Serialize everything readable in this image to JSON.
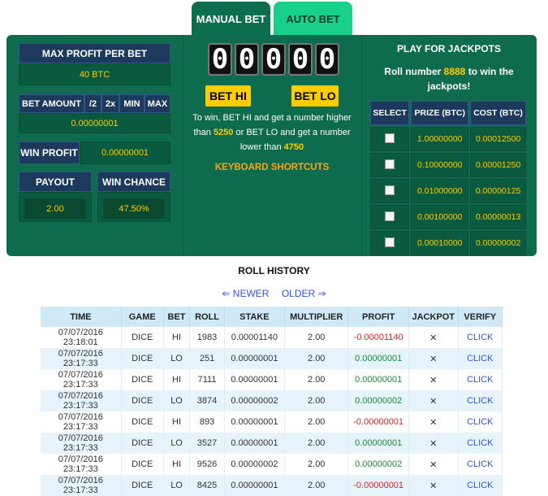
{
  "tabs": {
    "manual": "MANUAL BET",
    "auto": "AUTO BET"
  },
  "left": {
    "max_profit_label": "MAX PROFIT PER BET",
    "max_profit_value": "40 BTC",
    "bet_amount_label": "BET AMOUNT",
    "half": "/2",
    "double": "2x",
    "min": "MIN",
    "max": "MAX",
    "bet_amount_value": "0.00000001",
    "win_profit_label": "WIN PROFIT",
    "win_profit_value": "0.00000001",
    "payout_label": "PAYOUT",
    "payout_value": "2.00",
    "win_chance_label": "WIN CHANCE",
    "win_chance_value": "47.50%"
  },
  "mid": {
    "digits": [
      "0",
      "0",
      "0",
      "0",
      "0"
    ],
    "bet_hi": "BET HI",
    "bet_lo": "BET LO",
    "t1": "To win, BET HI and get a number higher than",
    "hi_num": "5250",
    "t2": "or BET LO and get a number lower than",
    "lo_num": "4750",
    "shortcuts": "KEYBOARD SHORTCUTS"
  },
  "jackpot": {
    "title": "PLAY FOR JACKPOTS",
    "sub1": "Roll number",
    "num": "8888",
    "sub2": "to win the jackpots!",
    "headers": [
      "SELECT",
      "PRIZE (BTC)",
      "COST (BTC)"
    ],
    "rows": [
      {
        "prize": "1.00000000",
        "cost": "0.00012500"
      },
      {
        "prize": "0.10000000",
        "cost": "0.00001250"
      },
      {
        "prize": "0.01000000",
        "cost": "0.00000125"
      },
      {
        "prize": "0.00100000",
        "cost": "0.00000013"
      },
      {
        "prize": "0.00010000",
        "cost": "0.00000002"
      }
    ]
  },
  "history": {
    "title": "ROLL HISTORY",
    "newer": "⇐ NEWER",
    "older": "OLDER ⇒",
    "headers": [
      "TIME",
      "GAME",
      "BET",
      "ROLL",
      "STAKE",
      "MULTIPLIER",
      "PROFIT",
      "JACKPOT",
      "VERIFY"
    ],
    "rows": [
      {
        "time": "07/07/2016 23:18:01",
        "game": "DICE",
        "bet": "HI",
        "roll": "1983",
        "stake": "0.00001140",
        "mult": "2.00",
        "profit": "-0.00001140",
        "jackpot": "✕",
        "verify": "CLICK",
        "win": false
      },
      {
        "time": "07/07/2016 23:17:33",
        "game": "DICE",
        "bet": "LO",
        "roll": "251",
        "stake": "0.00000001",
        "mult": "2.00",
        "profit": "0.00000001",
        "jackpot": "✕",
        "verify": "CLICK",
        "win": true
      },
      {
        "time": "07/07/2016 23:17:33",
        "game": "DICE",
        "bet": "HI",
        "roll": "7111",
        "stake": "0.00000001",
        "mult": "2.00",
        "profit": "0.00000001",
        "jackpot": "✕",
        "verify": "CLICK",
        "win": true
      },
      {
        "time": "07/07/2016 23:17:33",
        "game": "DICE",
        "bet": "LO",
        "roll": "3874",
        "stake": "0.00000002",
        "mult": "2.00",
        "profit": "0.00000002",
        "jackpot": "✕",
        "verify": "CLICK",
        "win": true
      },
      {
        "time": "07/07/2016 23:17:33",
        "game": "DICE",
        "bet": "HI",
        "roll": "893",
        "stake": "0.00000001",
        "mult": "2.00",
        "profit": "-0.00000001",
        "jackpot": "✕",
        "verify": "CLICK",
        "win": false
      },
      {
        "time": "07/07/2016 23:17:33",
        "game": "DICE",
        "bet": "LO",
        "roll": "3527",
        "stake": "0.00000001",
        "mult": "2.00",
        "profit": "0.00000001",
        "jackpot": "✕",
        "verify": "CLICK",
        "win": true
      },
      {
        "time": "07/07/2016 23:17:33",
        "game": "DICE",
        "bet": "HI",
        "roll": "9526",
        "stake": "0.00000002",
        "mult": "2.00",
        "profit": "0.00000002",
        "jackpot": "✕",
        "verify": "CLICK",
        "win": true
      },
      {
        "time": "07/07/2016 23:17:33",
        "game": "DICE",
        "bet": "LO",
        "roll": "8425",
        "stake": "0.00000001",
        "mult": "2.00",
        "profit": "-0.00000001",
        "jackpot": "✕",
        "verify": "CLICK",
        "win": false
      }
    ]
  }
}
